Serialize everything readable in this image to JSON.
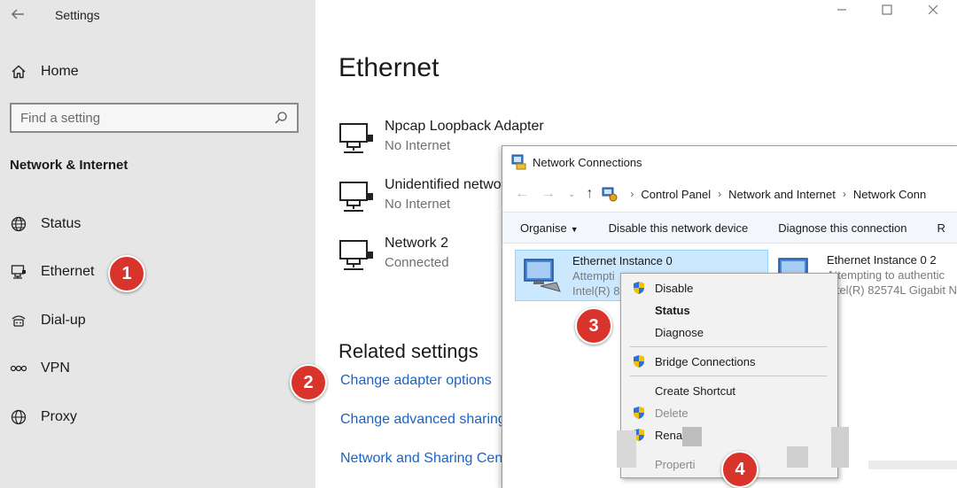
{
  "settings": {
    "app_title": "Settings",
    "home_label": "Home",
    "search_placeholder": "Find a setting",
    "section_title": "Network & Internet",
    "nav": [
      {
        "label": "Status",
        "icon": "globe-icon"
      },
      {
        "label": "Ethernet",
        "icon": "ethernet-icon"
      },
      {
        "label": "Dial-up",
        "icon": "dialup-icon"
      },
      {
        "label": "VPN",
        "icon": "vpn-icon"
      },
      {
        "label": "Proxy",
        "icon": "globe-icon"
      }
    ]
  },
  "main": {
    "title": "Ethernet",
    "adapters": [
      {
        "name": "Npcap Loopback Adapter",
        "status": "No Internet"
      },
      {
        "name": "Unidentified netwo",
        "status": "No Internet"
      },
      {
        "name": "Network 2",
        "status": "Connected"
      }
    ],
    "related_title": "Related settings",
    "related_links": [
      "Change adapter options",
      "Change advanced sharing",
      "Network and Sharing Cent"
    ]
  },
  "callouts": [
    "1",
    "2",
    "3",
    "4"
  ],
  "network_connections": {
    "title": "Network Connections",
    "breadcrumb": [
      "Control Panel",
      "Network and Internet",
      "Network Conn"
    ],
    "toolbar": {
      "organise": "Organise",
      "disable": "Disable this network device",
      "diagnose": "Diagnose this connection",
      "cut": "R"
    },
    "items": [
      {
        "name": "Ethernet Instance 0",
        "status": "Attempti",
        "device": "Intel(R) 8"
      },
      {
        "name": "Ethernet Instance 0 2",
        "status": "Attempting to authentic",
        "device": "Intel(R) 82574L Gigabit N"
      }
    ]
  },
  "context_menu": {
    "items": [
      {
        "label": "Disable"
      },
      {
        "label": "Status"
      },
      {
        "label": "Diagnose"
      },
      {
        "label": "Bridge Connections"
      },
      {
        "label": "Create Shortcut"
      },
      {
        "label": "Delete"
      },
      {
        "label": "Rena"
      },
      {
        "label": "Properti"
      }
    ]
  },
  "colors": {
    "accent_link": "#1764c6",
    "badge": "#d9342b",
    "sidebar_bg": "#e6e6e6",
    "selection": "#cce8ff"
  }
}
